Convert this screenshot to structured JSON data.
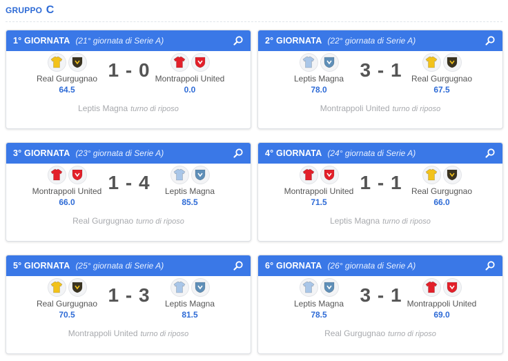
{
  "group": {
    "prefix": "GRUPPO",
    "letter": "C"
  },
  "colors": {
    "header_blue": "#3a78e7",
    "score_blue": "#2e6bd6",
    "card_border": "#dcdfe4"
  },
  "matches": [
    {
      "round": "1° GIORNATA",
      "serie": "(21° giornata di Serie A)",
      "home": {
        "name": "Real Gurgugnao",
        "score": "64.5",
        "kit": "yellow"
      },
      "away": {
        "name": "Montrappoli United",
        "score": "0.0",
        "kit": "red"
      },
      "result": "1 - 0",
      "rest": {
        "team": "Leptis Magna",
        "label": "turno di riposo"
      }
    },
    {
      "round": "2° GIORNATA",
      "serie": "(22° giornata di Serie A)",
      "home": {
        "name": "Leptis Magna",
        "score": "78.0",
        "kit": "lightblue"
      },
      "away": {
        "name": "Real Gurgugnao",
        "score": "67.5",
        "kit": "yellow"
      },
      "result": "3 - 1",
      "rest": {
        "team": "Montrappoli United",
        "label": "turno di riposo"
      }
    },
    {
      "round": "3° GIORNATA",
      "serie": "(23° giornata di Serie A)",
      "home": {
        "name": "Montrappoli United",
        "score": "66.0",
        "kit": "red"
      },
      "away": {
        "name": "Leptis Magna",
        "score": "85.5",
        "kit": "lightblue"
      },
      "result": "1 - 4",
      "rest": {
        "team": "Real Gurgugnao",
        "label": "turno di riposo"
      }
    },
    {
      "round": "4° GIORNATA",
      "serie": "(24° giornata di Serie A)",
      "home": {
        "name": "Montrappoli United",
        "score": "71.5",
        "kit": "red"
      },
      "away": {
        "name": "Real Gurgugnao",
        "score": "66.0",
        "kit": "yellow"
      },
      "result": "1 - 1",
      "rest": {
        "team": "Leptis Magna",
        "label": "turno di riposo"
      }
    },
    {
      "round": "5° GIORNATA",
      "serie": "(25° giornata di Serie A)",
      "home": {
        "name": "Real Gurgugnao",
        "score": "70.5",
        "kit": "yellow"
      },
      "away": {
        "name": "Leptis Magna",
        "score": "81.5",
        "kit": "lightblue"
      },
      "result": "1 - 3",
      "rest": {
        "team": "Montrappoli United",
        "label": "turno di riposo"
      }
    },
    {
      "round": "6° GIORNATA",
      "serie": "(26° giornata di Serie A)",
      "home": {
        "name": "Leptis Magna",
        "score": "78.5",
        "kit": "lightblue"
      },
      "away": {
        "name": "Montrappoli United",
        "score": "69.0",
        "kit": "red"
      },
      "result": "3 - 1",
      "rest": {
        "team": "Real Gurgugnao",
        "label": "turno di riposo"
      }
    }
  ]
}
